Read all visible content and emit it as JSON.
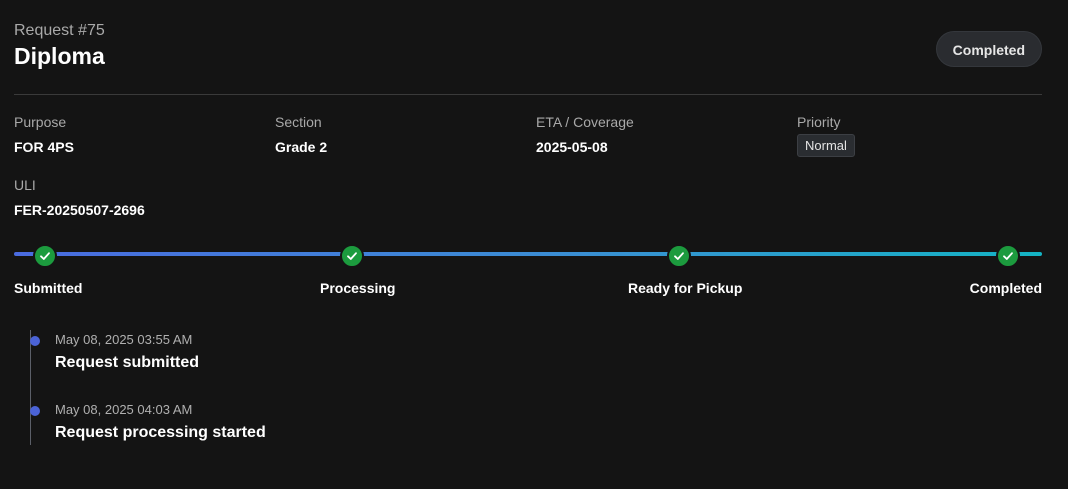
{
  "header": {
    "request_number": "Request #75",
    "title": "Diploma",
    "status": "Completed"
  },
  "details": {
    "purpose": {
      "label": "Purpose",
      "value": "FOR 4PS"
    },
    "section": {
      "label": "Section",
      "value": "Grade 2"
    },
    "eta": {
      "label": "ETA / Coverage",
      "value": "2025-05-08"
    },
    "priority": {
      "label": "Priority",
      "value": "Normal"
    },
    "uli": {
      "label": "ULI",
      "value": "FER-20250507-2696"
    }
  },
  "progress": {
    "steps": [
      {
        "label": "Submitted",
        "done": true
      },
      {
        "label": "Processing",
        "done": true
      },
      {
        "label": "Ready for Pickup",
        "done": true
      },
      {
        "label": "Completed",
        "done": true
      }
    ],
    "icon": "check-icon",
    "colors": {
      "track_start": "#4a6be0",
      "track_end": "#14b4c4",
      "step_done": "#1c9b3e"
    }
  },
  "timeline": {
    "events": [
      {
        "time": "May 08, 2025 03:55 AM",
        "title": "Request submitted"
      },
      {
        "time": "May 08, 2025 04:03 AM",
        "title": "Request processing started"
      }
    ],
    "dot_color": "#4b63d6"
  }
}
